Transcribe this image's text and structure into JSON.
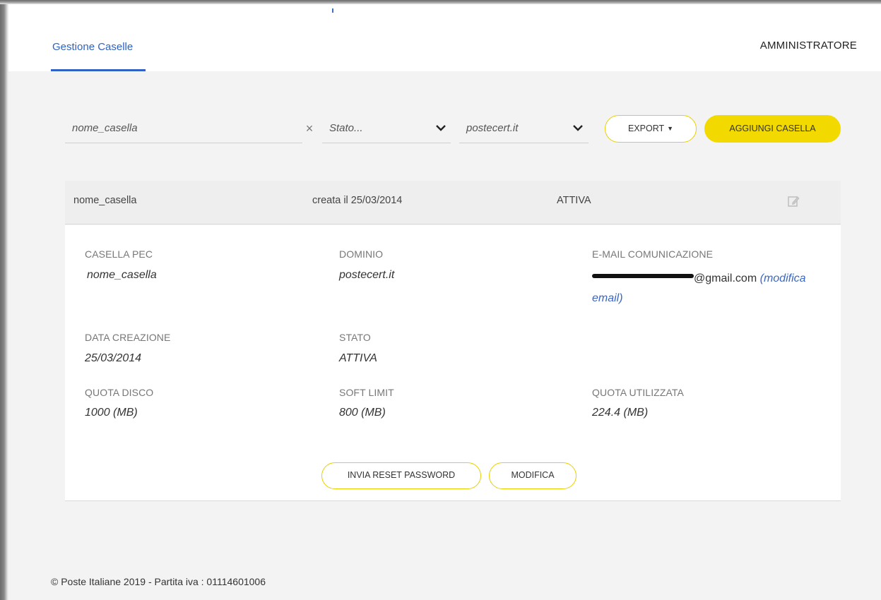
{
  "header": {
    "tab_label": "Gestione Caselle",
    "user_role": "AMMINISTRATORE"
  },
  "filters": {
    "name_placeholder": "nome_casella",
    "clear_glyph": "×",
    "state_placeholder": "Stato...",
    "domain_value": "postecert.it",
    "export_label": "EXPORT",
    "add_label": "AGGIUNGI CASELLA"
  },
  "row": {
    "name": "nome_casella",
    "created": "creata il 25/03/2014",
    "status": "ATTIVA",
    "edit_icon": "edit-icon"
  },
  "details": {
    "casella_label": "CASELLA PEC",
    "casella_value": "nome_casella",
    "dominio_label": "DOMINIO",
    "dominio_value": "postecert.it",
    "email_label": "E-MAIL COMUNICAZIONE",
    "email_domain": "@gmail.com",
    "email_link": "(modifica email)",
    "data_label": "DATA CREAZIONE",
    "data_value": "25/03/2014",
    "stato_label": "STATO",
    "stato_value": "ATTIVA",
    "quota_label": "QUOTA DISCO",
    "quota_value": "1000 (MB)",
    "soft_label": "SOFT LIMIT",
    "soft_value": "800 (MB)",
    "used_label": "QUOTA UTILIZZATA",
    "used_value": "224.4 (MB)",
    "reset_button": "INVIA RESET PASSWORD",
    "modify_button": "MODIFICA"
  },
  "footer": {
    "text": "© Poste Italiane 2019 - Partita iva : 01114601006"
  },
  "colors": {
    "accent_blue": "#2f62c2",
    "accent_yellow": "#f2d900",
    "background": "#f3f3f3"
  }
}
